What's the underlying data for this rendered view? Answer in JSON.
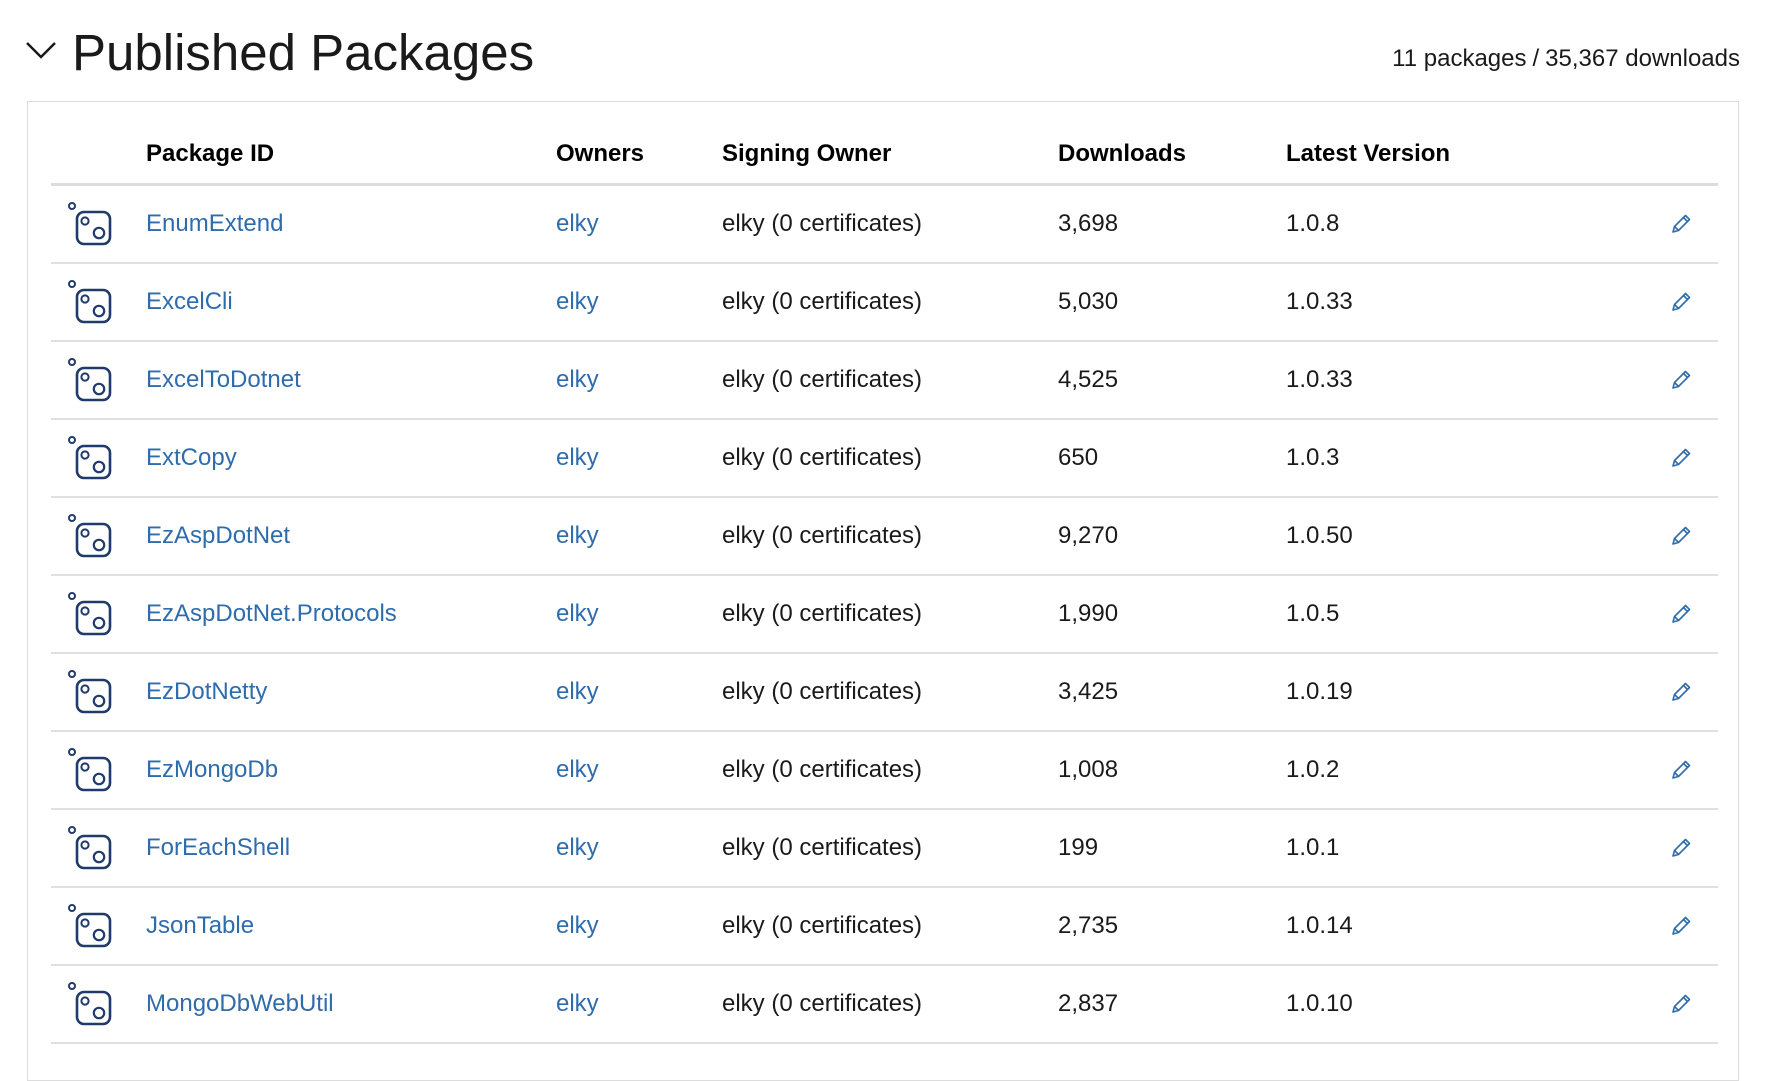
{
  "section": {
    "title": "Published Packages",
    "summary_packages": "11 packages",
    "summary_sep": "/",
    "summary_downloads": "35,367 downloads"
  },
  "table": {
    "headers": {
      "package_id": "Package ID",
      "owners": "Owners",
      "signing_owner": "Signing Owner",
      "downloads": "Downloads",
      "latest_version": "Latest Version"
    },
    "rows": [
      {
        "id": "EnumExtend",
        "owner": "elky",
        "signing": "elky (0 certificates)",
        "downloads": "3,698",
        "version": "1.0.8"
      },
      {
        "id": "ExcelCli",
        "owner": "elky",
        "signing": "elky (0 certificates)",
        "downloads": "5,030",
        "version": "1.0.33"
      },
      {
        "id": "ExcelToDotnet",
        "owner": "elky",
        "signing": "elky (0 certificates)",
        "downloads": "4,525",
        "version": "1.0.33"
      },
      {
        "id": "ExtCopy",
        "owner": "elky",
        "signing": "elky (0 certificates)",
        "downloads": "650",
        "version": "1.0.3"
      },
      {
        "id": "EzAspDotNet",
        "owner": "elky",
        "signing": "elky (0 certificates)",
        "downloads": "9,270",
        "version": "1.0.50"
      },
      {
        "id": "EzAspDotNet.Protocols",
        "owner": "elky",
        "signing": "elky (0 certificates)",
        "downloads": "1,990",
        "version": "1.0.5"
      },
      {
        "id": "EzDotNetty",
        "owner": "elky",
        "signing": "elky (0 certificates)",
        "downloads": "3,425",
        "version": "1.0.19"
      },
      {
        "id": "EzMongoDb",
        "owner": "elky",
        "signing": "elky (0 certificates)",
        "downloads": "1,008",
        "version": "1.0.2"
      },
      {
        "id": "ForEachShell",
        "owner": "elky",
        "signing": "elky (0 certificates)",
        "downloads": "199",
        "version": "1.0.1"
      },
      {
        "id": "JsonTable",
        "owner": "elky",
        "signing": "elky (0 certificates)",
        "downloads": "2,735",
        "version": "1.0.14"
      },
      {
        "id": "MongoDbWebUtil",
        "owner": "elky",
        "signing": "elky (0 certificates)",
        "downloads": "2,837",
        "version": "1.0.10"
      }
    ]
  },
  "icons": {
    "toggle": "chevron-down-icon",
    "package": "package-icon",
    "edit": "pencil-icon"
  },
  "colors": {
    "link": "#2f6cab",
    "icon": "#1f3a6b",
    "divider": "#e0e0e0"
  }
}
